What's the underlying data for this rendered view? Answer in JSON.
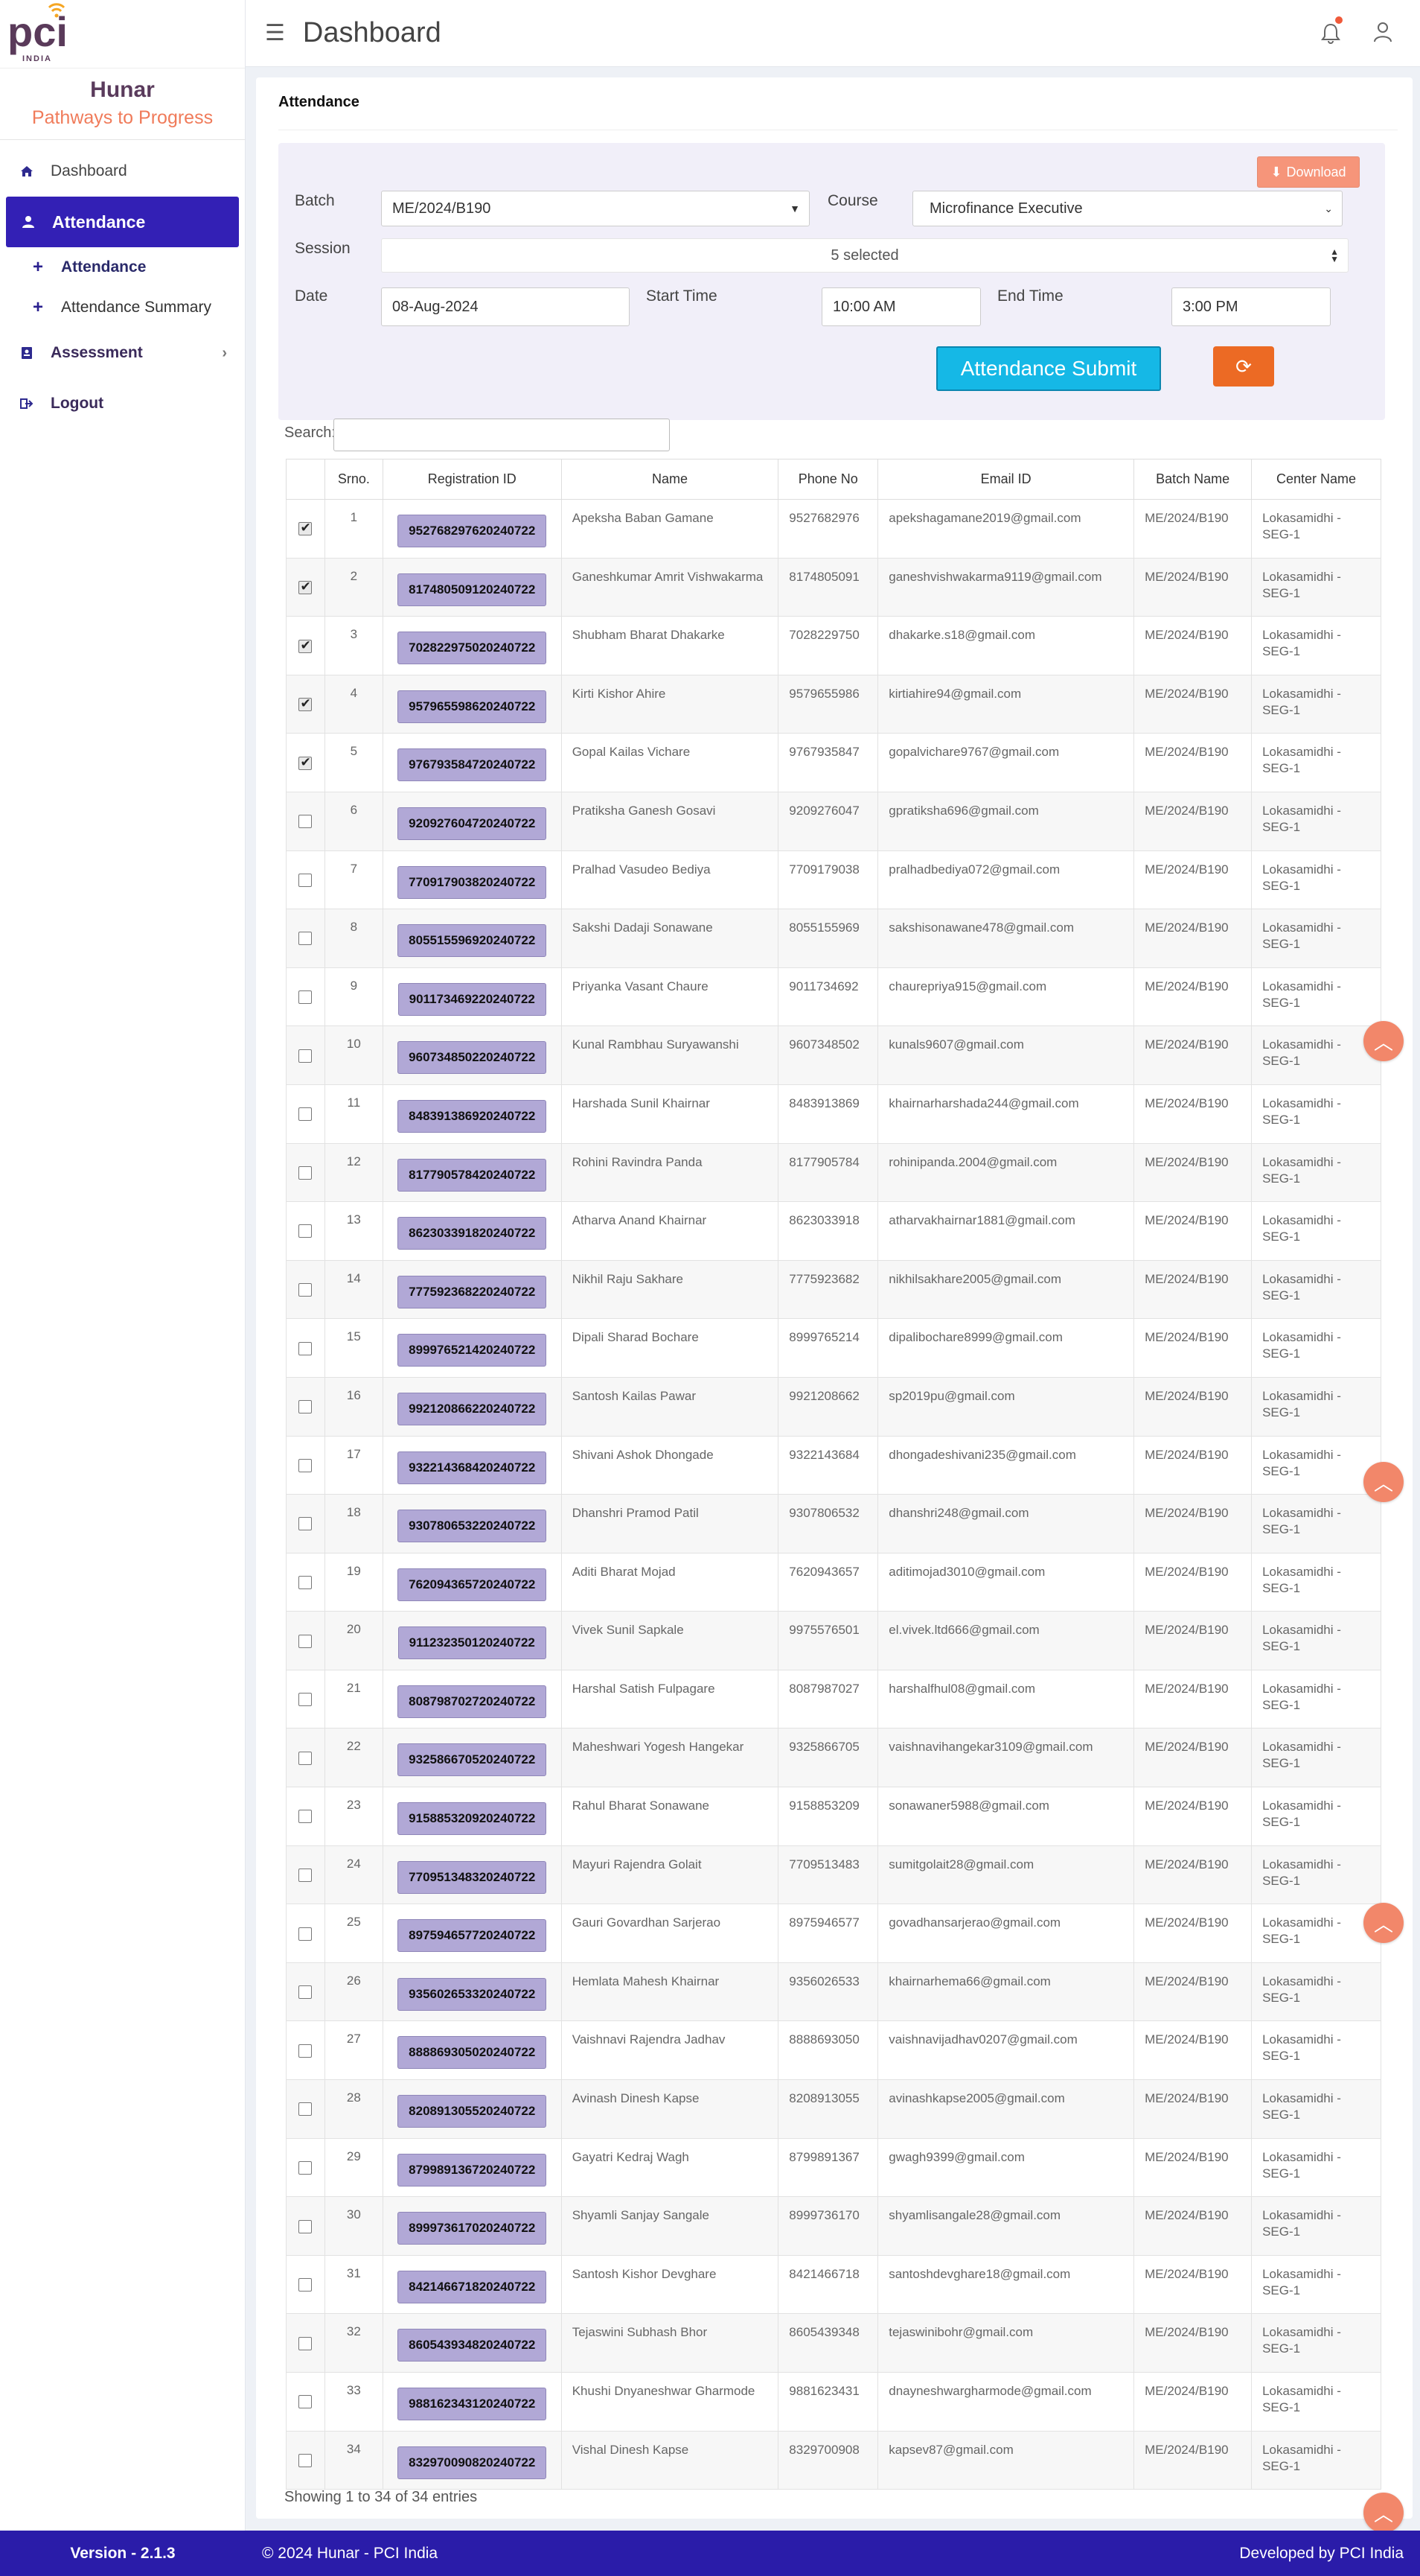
{
  "sidebar": {
    "logo_text": "INDIA",
    "brand_title": "Hunar",
    "brand_subtitle": "Pathways to Progress",
    "items": [
      {
        "label": "Dashboard",
        "icon": "home-icon"
      },
      {
        "label": "Attendance",
        "icon": "user-icon",
        "active": true
      },
      {
        "label": "Attendance",
        "icon": "plus-icon",
        "sub": true,
        "current": true
      },
      {
        "label": "Attendance Summary",
        "icon": "plus-icon",
        "sub": true
      },
      {
        "label": "Assessment",
        "icon": "id-card-icon"
      },
      {
        "label": "Logout",
        "icon": "logout-icon"
      }
    ]
  },
  "header": {
    "title": "Dashboard"
  },
  "card": {
    "title": "Attendance"
  },
  "filter": {
    "download_label": "Download",
    "batch_label": "Batch",
    "batch_value": "ME/2024/B190",
    "course_label": "Course",
    "course_value": "Microfinance Executive",
    "session_label": "Session",
    "session_value": "5 selected",
    "date_label": "Date",
    "date_value": "08-Aug-2024",
    "start_label": "Start Time",
    "start_value": "10:00 AM",
    "end_label": "End Time",
    "end_value": "3:00 PM"
  },
  "actions": {
    "submit_label": "Attendance Submit",
    "refresh_icon": "refresh-icon"
  },
  "search": {
    "label": "Search:"
  },
  "table": {
    "headers": [
      "",
      "Srno.",
      "Registration ID",
      "Name",
      "Phone No",
      "Email ID",
      "Batch Name",
      "Center Name"
    ],
    "rows": [
      {
        "checked": true,
        "sr": "1",
        "reg": "952768297620240722",
        "name": "Apeksha Baban Gamane",
        "phone": "9527682976",
        "email": "apekshagamane2019@gmail.com",
        "batch": "ME/2024/B190",
        "center": "Lokasamidhi - SEG-1"
      },
      {
        "checked": true,
        "sr": "2",
        "reg": "817480509120240722",
        "name": "Ganeshkumar Amrit Vishwakarma",
        "phone": "8174805091",
        "email": "ganeshvishwakarma9119@gmail.com",
        "batch": "ME/2024/B190",
        "center": "Lokasamidhi - SEG-1"
      },
      {
        "checked": true,
        "sr": "3",
        "reg": "702822975020240722",
        "name": "Shubham Bharat Dhakarke",
        "phone": "7028229750",
        "email": "dhakarke.s18@gmail.com",
        "batch": "ME/2024/B190",
        "center": "Lokasamidhi - SEG-1"
      },
      {
        "checked": true,
        "sr": "4",
        "reg": "957965598620240722",
        "name": "Kirti Kishor Ahire",
        "phone": "9579655986",
        "email": "kirtiahire94@gmail.com",
        "batch": "ME/2024/B190",
        "center": "Lokasamidhi - SEG-1"
      },
      {
        "checked": true,
        "sr": "5",
        "reg": "976793584720240722",
        "name": "Gopal Kailas Vichare",
        "phone": "9767935847",
        "email": "gopalvichare9767@gmail.com",
        "batch": "ME/2024/B190",
        "center": "Lokasamidhi - SEG-1"
      },
      {
        "checked": false,
        "sr": "6",
        "reg": "920927604720240722",
        "name": "Pratiksha Ganesh Gosavi",
        "phone": "9209276047",
        "email": "gpratiksha696@gmail.com",
        "batch": "ME/2024/B190",
        "center": "Lokasamidhi - SEG-1"
      },
      {
        "checked": false,
        "sr": "7",
        "reg": "770917903820240722",
        "name": "Pralhad Vasudeo Bediya",
        "phone": "7709179038",
        "email": "pralhadbediya072@gmail.com",
        "batch": "ME/2024/B190",
        "center": "Lokasamidhi - SEG-1"
      },
      {
        "checked": false,
        "sr": "8",
        "reg": "805515596920240722",
        "name": "Sakshi Dadaji Sonawane",
        "phone": "8055155969",
        "email": "sakshisonawane478@gmail.com",
        "batch": "ME/2024/B190",
        "center": "Lokasamidhi - SEG-1"
      },
      {
        "checked": false,
        "sr": "9",
        "reg": "901173469220240722",
        "name": "Priyanka Vasant Chaure",
        "phone": "9011734692",
        "email": "chaurepriya915@gmail.com",
        "batch": "ME/2024/B190",
        "center": "Lokasamidhi - SEG-1"
      },
      {
        "checked": false,
        "sr": "10",
        "reg": "960734850220240722",
        "name": "Kunal Rambhau Suryawanshi",
        "phone": "9607348502",
        "email": "kunals9607@gmail.com",
        "batch": "ME/2024/B190",
        "center": "Lokasamidhi - SEG-1"
      },
      {
        "checked": false,
        "sr": "11",
        "reg": "848391386920240722",
        "name": "Harshada Sunil Khairnar",
        "phone": "8483913869",
        "email": "khairnarharshada244@gmail.com",
        "batch": "ME/2024/B190",
        "center": "Lokasamidhi - SEG-1"
      },
      {
        "checked": false,
        "sr": "12",
        "reg": "817790578420240722",
        "name": "Rohini Ravindra Panda",
        "phone": "8177905784",
        "email": "rohinipanda.2004@gmail.com",
        "batch": "ME/2024/B190",
        "center": "Lokasamidhi - SEG-1"
      },
      {
        "checked": false,
        "sr": "13",
        "reg": "862303391820240722",
        "name": "Atharva Anand Khairnar",
        "phone": "8623033918",
        "email": "atharvakhairnar1881@gmail.com",
        "batch": "ME/2024/B190",
        "center": "Lokasamidhi - SEG-1"
      },
      {
        "checked": false,
        "sr": "14",
        "reg": "777592368220240722",
        "name": "Nikhil Raju Sakhare",
        "phone": "7775923682",
        "email": "nikhilsakhare2005@gmail.com",
        "batch": "ME/2024/B190",
        "center": "Lokasamidhi - SEG-1"
      },
      {
        "checked": false,
        "sr": "15",
        "reg": "899976521420240722",
        "name": "Dipali Sharad Bochare",
        "phone": "8999765214",
        "email": "dipalibochare8999@gmail.com",
        "batch": "ME/2024/B190",
        "center": "Lokasamidhi - SEG-1"
      },
      {
        "checked": false,
        "sr": "16",
        "reg": "992120866220240722",
        "name": "Santosh Kailas Pawar",
        "phone": "9921208662",
        "email": "sp2019pu@gmail.com",
        "batch": "ME/2024/B190",
        "center": "Lokasamidhi - SEG-1"
      },
      {
        "checked": false,
        "sr": "17",
        "reg": "932214368420240722",
        "name": "Shivani Ashok Dhongade",
        "phone": "9322143684",
        "email": "dhongadeshivani235@gmail.com",
        "batch": "ME/2024/B190",
        "center": "Lokasamidhi - SEG-1"
      },
      {
        "checked": false,
        "sr": "18",
        "reg": "930780653220240722",
        "name": "Dhanshri Pramod Patil",
        "phone": "9307806532",
        "email": "dhanshri248@gmail.com",
        "batch": "ME/2024/B190",
        "center": "Lokasamidhi - SEG-1"
      },
      {
        "checked": false,
        "sr": "19",
        "reg": "762094365720240722",
        "name": "Aditi Bharat Mojad",
        "phone": "7620943657",
        "email": "aditimojad3010@gmail.com",
        "batch": "ME/2024/B190",
        "center": "Lokasamidhi - SEG-1"
      },
      {
        "checked": false,
        "sr": "20",
        "reg": "911232350120240722",
        "name": "Vivek Sunil Sapkale",
        "phone": "9975576501",
        "email": "el.vivek.ltd666@gmail.com",
        "batch": "ME/2024/B190",
        "center": "Lokasamidhi - SEG-1"
      },
      {
        "checked": false,
        "sr": "21",
        "reg": "808798702720240722",
        "name": "Harshal Satish Fulpagare",
        "phone": "8087987027",
        "email": "harshalfhul08@gmail.com",
        "batch": "ME/2024/B190",
        "center": "Lokasamidhi - SEG-1"
      },
      {
        "checked": false,
        "sr": "22",
        "reg": "932586670520240722",
        "name": "Maheshwari Yogesh Hangekar",
        "phone": "9325866705",
        "email": "vaishnavihangekar3109@gmail.com",
        "batch": "ME/2024/B190",
        "center": "Lokasamidhi - SEG-1"
      },
      {
        "checked": false,
        "sr": "23",
        "reg": "915885320920240722",
        "name": "Rahul Bharat Sonawane",
        "phone": "9158853209",
        "email": "sonawaner5988@gmail.com",
        "batch": "ME/2024/B190",
        "center": "Lokasamidhi - SEG-1"
      },
      {
        "checked": false,
        "sr": "24",
        "reg": "770951348320240722",
        "name": "Mayuri Rajendra Golait",
        "phone": "7709513483",
        "email": "sumitgolait28@gmail.com",
        "batch": "ME/2024/B190",
        "center": "Lokasamidhi - SEG-1"
      },
      {
        "checked": false,
        "sr": "25",
        "reg": "897594657720240722",
        "name": "Gauri Govardhan Sarjerao",
        "phone": "8975946577",
        "email": "govadhansarjerao@gmail.com",
        "batch": "ME/2024/B190",
        "center": "Lokasamidhi - SEG-1"
      },
      {
        "checked": false,
        "sr": "26",
        "reg": "935602653320240722",
        "name": "Hemlata Mahesh Khairnar",
        "phone": "9356026533",
        "email": "khairnarhema66@gmail.com",
        "batch": "ME/2024/B190",
        "center": "Lokasamidhi - SEG-1"
      },
      {
        "checked": false,
        "sr": "27",
        "reg": "888869305020240722",
        "name": "Vaishnavi Rajendra Jadhav",
        "phone": "8888693050",
        "email": "vaishnavijadhav0207@gmail.com",
        "batch": "ME/2024/B190",
        "center": "Lokasamidhi - SEG-1"
      },
      {
        "checked": false,
        "sr": "28",
        "reg": "820891305520240722",
        "name": "Avinash Dinesh Kapse",
        "phone": "8208913055",
        "email": "avinashkapse2005@gmail.com",
        "batch": "ME/2024/B190",
        "center": "Lokasamidhi - SEG-1"
      },
      {
        "checked": false,
        "sr": "29",
        "reg": "879989136720240722",
        "name": "Gayatri Kedraj Wagh",
        "phone": "8799891367",
        "email": "gwagh9399@gmail.com",
        "batch": "ME/2024/B190",
        "center": "Lokasamidhi - SEG-1"
      },
      {
        "checked": false,
        "sr": "30",
        "reg": "899973617020240722",
        "name": "Shyamli Sanjay Sangale",
        "phone": "8999736170",
        "email": "shyamlisangale28@gmail.com",
        "batch": "ME/2024/B190",
        "center": "Lokasamidhi - SEG-1"
      },
      {
        "checked": false,
        "sr": "31",
        "reg": "842146671820240722",
        "name": "Santosh Kishor Devghare",
        "phone": "8421466718",
        "email": "santoshdevghare18@gmail.com",
        "batch": "ME/2024/B190",
        "center": "Lokasamidhi - SEG-1"
      },
      {
        "checked": false,
        "sr": "32",
        "reg": "860543934820240722",
        "name": "Tejaswini Subhash Bhor",
        "phone": "8605439348",
        "email": "tejaswinibohr@gmail.com",
        "batch": "ME/2024/B190",
        "center": "Lokasamidhi - SEG-1"
      },
      {
        "checked": false,
        "sr": "33",
        "reg": "988162343120240722",
        "name": "Khushi Dnyaneshwar Gharmode",
        "phone": "9881623431",
        "email": "dnayneshwargharmode@gmail.com",
        "batch": "ME/2024/B190",
        "center": "Lokasamidhi - SEG-1"
      },
      {
        "checked": false,
        "sr": "34",
        "reg": "832970090820240722",
        "name": "Vishal Dinesh Kapse",
        "phone": "8329700908",
        "email": "kapsev87@gmail.com",
        "batch": "ME/2024/B190",
        "center": "Lokasamidhi - SEG-1"
      }
    ],
    "info": "Showing 1 to 34 of 34 entries"
  },
  "footer": {
    "version": "Version - 2.1.3",
    "copyright": "© 2024 Hunar - PCI India",
    "developed": "Developed by PCI India"
  },
  "colors": {
    "primary": "#3320b5",
    "accent": "#f2876a",
    "submit": "#15b8e6",
    "badge": "#b1a8d6"
  }
}
